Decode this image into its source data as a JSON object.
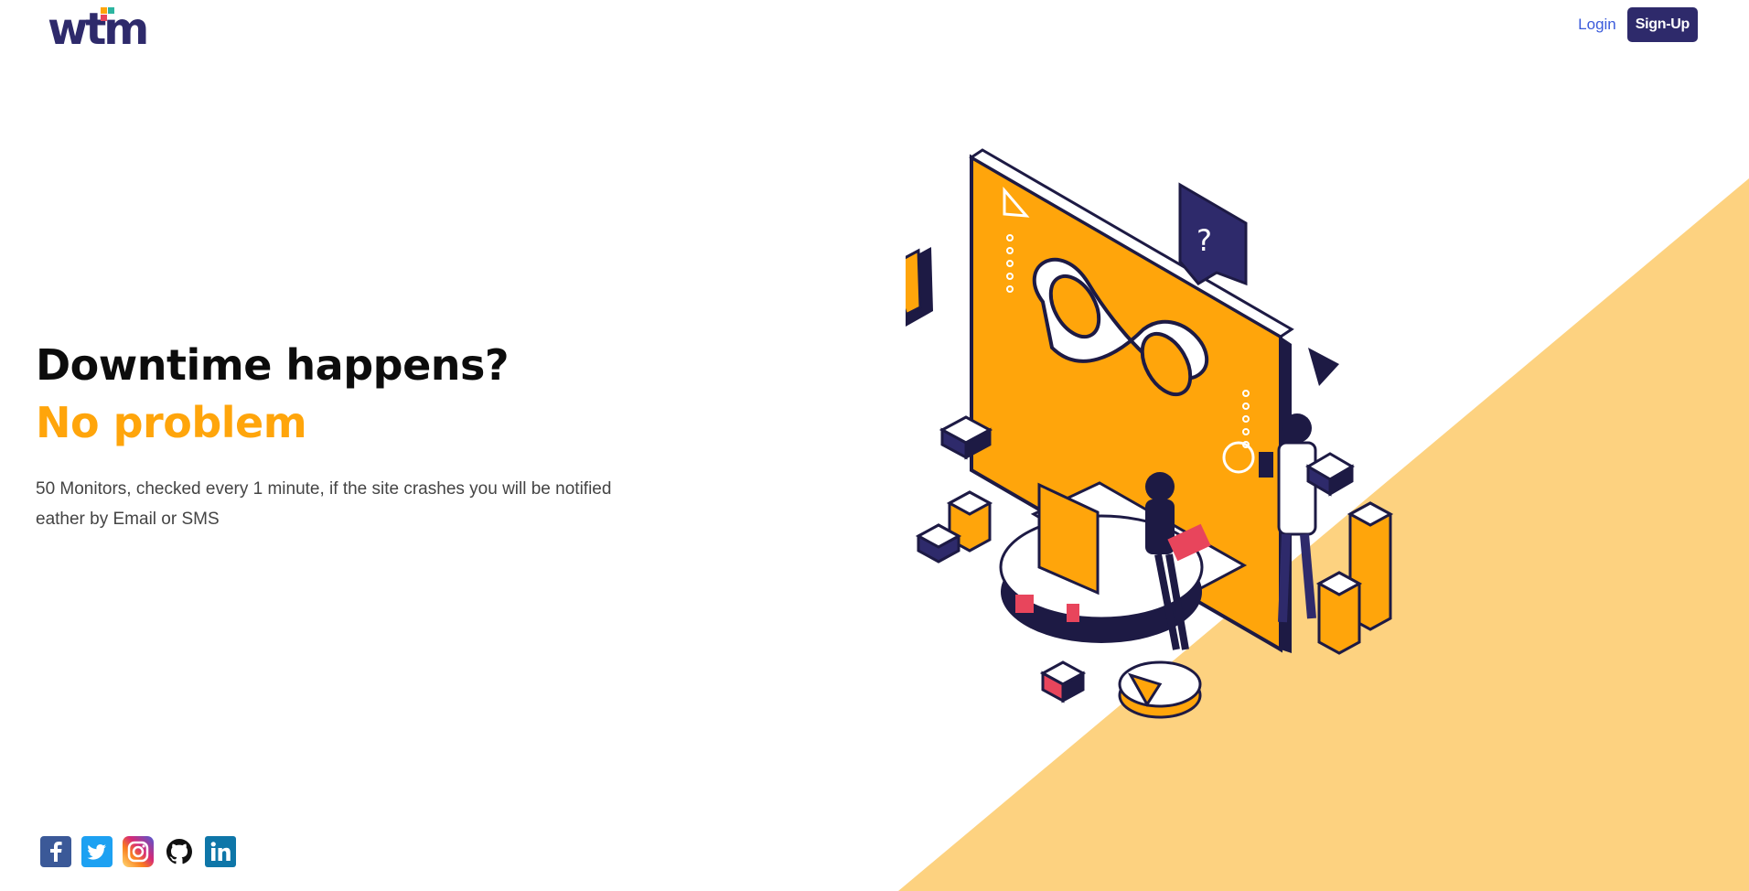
{
  "header": {
    "logo_text": "wtm",
    "login_label": "Login",
    "signup_label": "Sign-Up"
  },
  "hero": {
    "heading": "Downtime happens?",
    "subheading": "No problem",
    "description": "50 Monitors, checked every 1 minute, if the site crashes you will be notified eather by Email or SMS"
  },
  "social": [
    {
      "icon": "facebook-icon"
    },
    {
      "icon": "twitter-icon"
    },
    {
      "icon": "instagram-icon"
    },
    {
      "icon": "github-icon"
    },
    {
      "icon": "linkedin-icon"
    }
  ],
  "colors": {
    "brand": "#2e2a6b",
    "accent": "#ffa50b",
    "background_triangle": "#fdd280",
    "link": "#3b5bdb"
  }
}
